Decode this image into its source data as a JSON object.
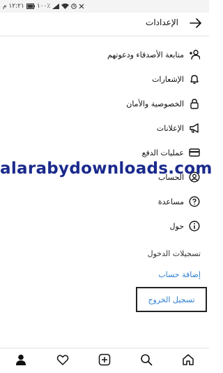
{
  "status_bar": {
    "time": "١٢:٢١ م",
    "battery": "١٠٠٪",
    "icons": [
      "battery-icon",
      "signal-icon",
      "wifi-icon",
      "alarm-icon",
      "mute-icon"
    ]
  },
  "header": {
    "title": "الإعدادات",
    "back_icon": "arrow-right-icon"
  },
  "menu": {
    "items": [
      {
        "label": "متابعة الأصدقاء ودعوتهم",
        "icon": "add-person-icon"
      },
      {
        "label": "الإشعارات",
        "icon": "bell-icon"
      },
      {
        "label": "الخصوصية والأمان",
        "icon": "lock-icon"
      },
      {
        "label": "الإعلانات",
        "icon": "megaphone-icon"
      },
      {
        "label": "عمليات الدفع",
        "icon": "credit-card-icon"
      },
      {
        "label": "الحساب",
        "icon": "account-circle-icon"
      },
      {
        "label": "مساعدة",
        "icon": "help-circle-icon"
      },
      {
        "label": "حول",
        "icon": "info-circle-icon"
      }
    ]
  },
  "logins": {
    "section_title": "تسجيلات الدخول",
    "add_account": "إضافة حساب",
    "logout": "تسجيل الخروج"
  },
  "watermark": "alarabydownloads.com",
  "tab_bar": {
    "tabs": [
      "profile-icon",
      "heart-icon",
      "plus-square-icon",
      "search-icon",
      "home-icon"
    ]
  },
  "colors": {
    "link": "#2d7fd1",
    "watermark": "#1a2a8c",
    "text": "#111111"
  }
}
